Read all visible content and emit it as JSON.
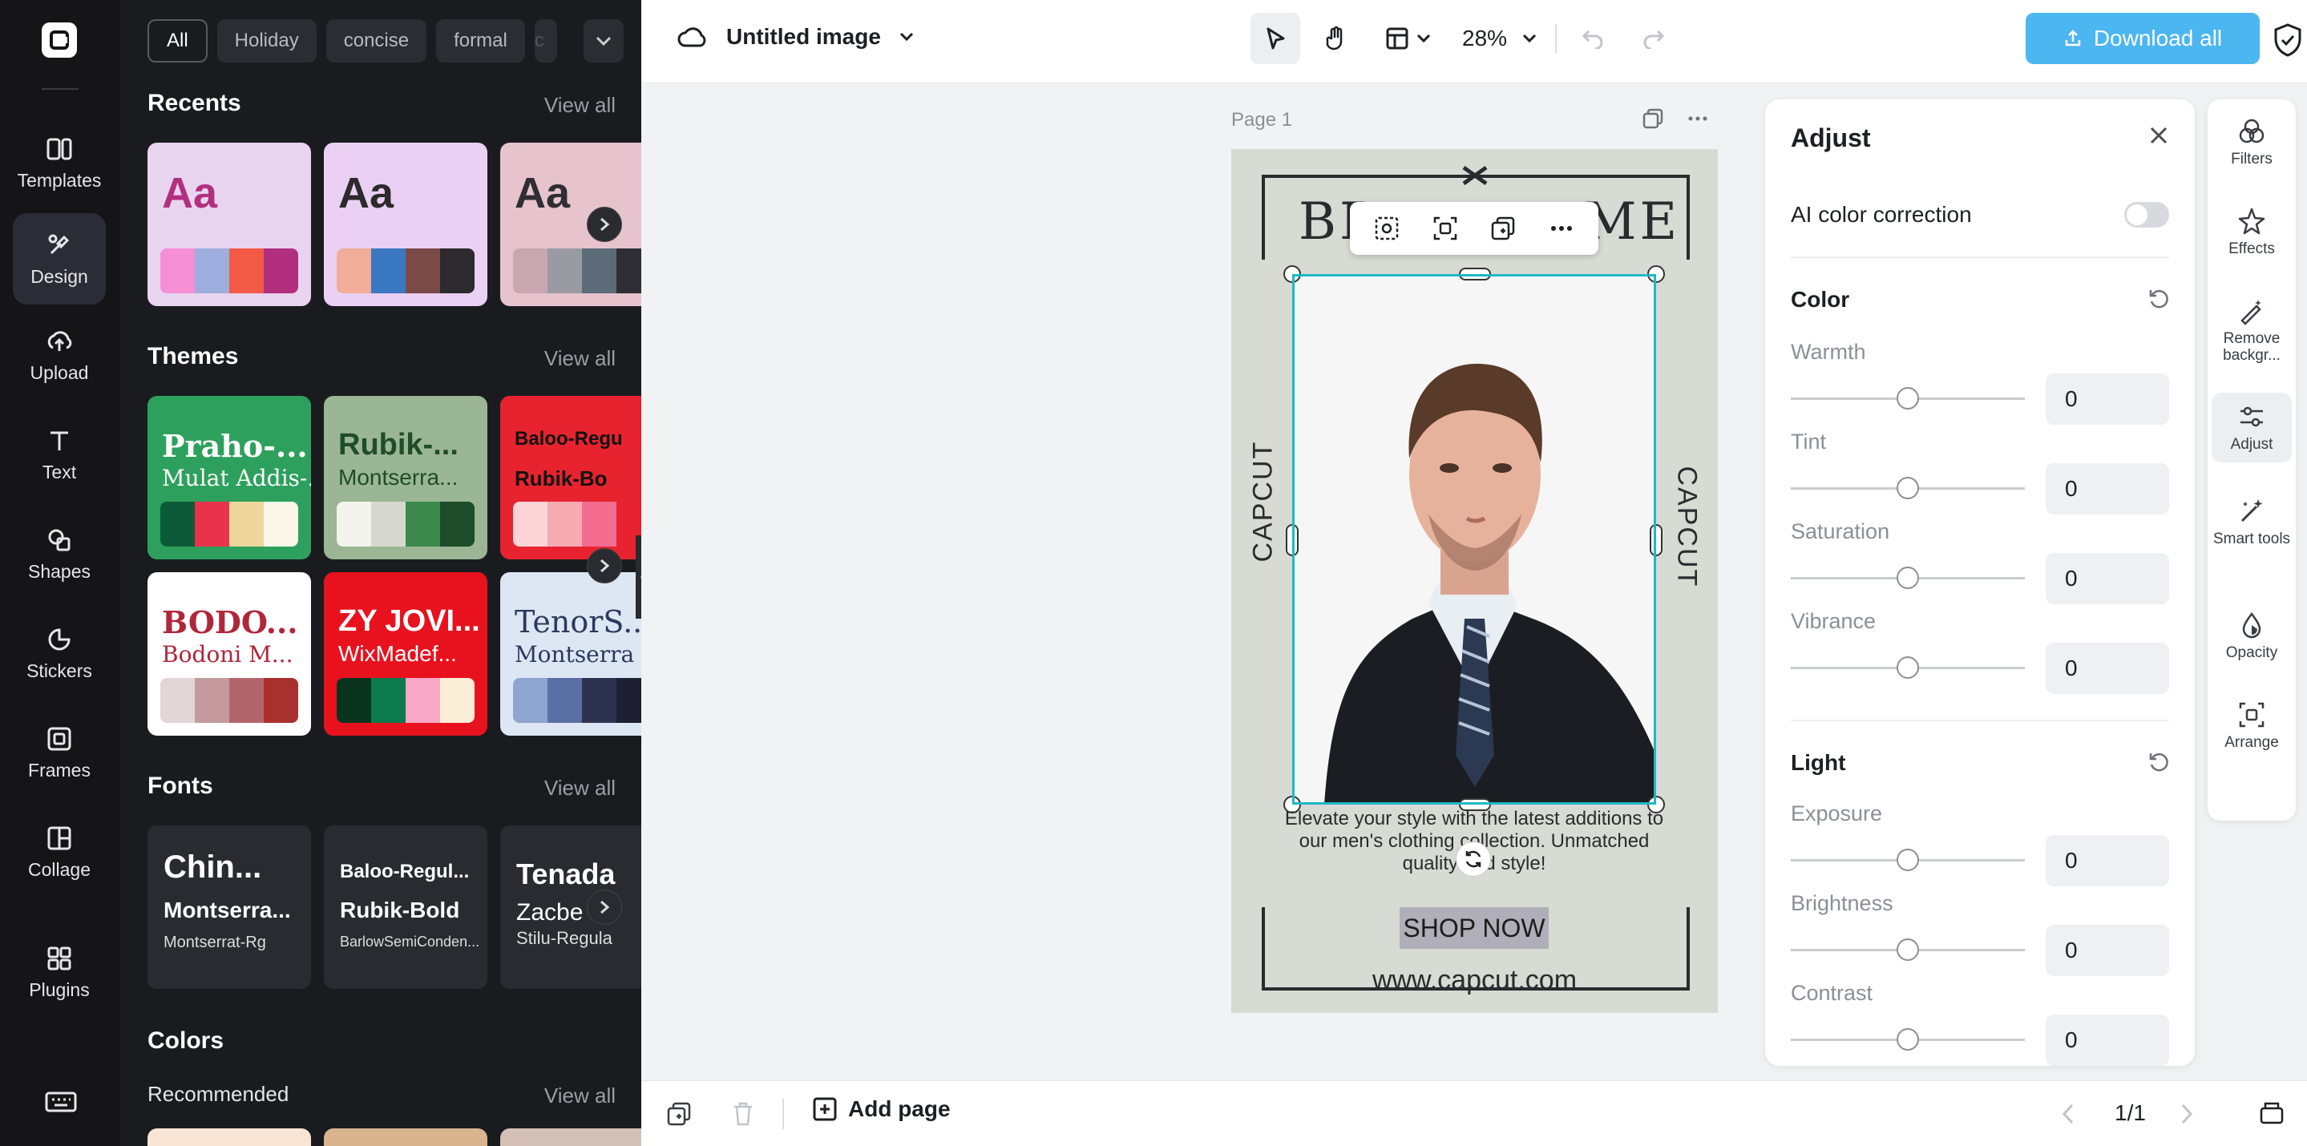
{
  "rail": {
    "items": [
      {
        "label": "Templates",
        "icon": "templates-icon"
      },
      {
        "label": "Design",
        "icon": "design-icon",
        "active": true
      },
      {
        "label": "Upload",
        "icon": "upload-icon"
      },
      {
        "label": "Text",
        "icon": "text-icon"
      },
      {
        "label": "Shapes",
        "icon": "shapes-icon"
      },
      {
        "label": "Stickers",
        "icon": "stickers-icon"
      },
      {
        "label": "Frames",
        "icon": "frames-icon"
      },
      {
        "label": "Collage",
        "icon": "collage-icon"
      },
      {
        "label": "Plugins",
        "icon": "plugins-icon"
      }
    ]
  },
  "panel": {
    "chips": [
      "All",
      "Holiday",
      "concise",
      "formal",
      "c"
    ],
    "recents": {
      "title": "Recents",
      "view_all": "View all",
      "cards": [
        {
          "text": "Aa",
          "text_color": "#b0307f",
          "bg": "#e9d4ef",
          "swatches": [
            "#f58fd6",
            "#9eaede",
            "#f25a46",
            "#b0307f"
          ]
        },
        {
          "text": "Aa",
          "text_color": "#2c2a2c",
          "bg": "#ead0f3",
          "swatches": [
            "#f1ad99",
            "#3a78c2",
            "#7a4a47",
            "#2c2a2c"
          ]
        },
        {
          "text": "Aa",
          "text_color": "#2f2e34",
          "bg": "#e6c3cd",
          "swatches": [
            "#c8a7b0",
            "#9a9aa2",
            "#5b6c78",
            "#2f2e34"
          ]
        }
      ]
    },
    "themes": {
      "title": "Themes",
      "view_all": "View all",
      "cards": [
        {
          "t1": "Praho-...",
          "t2": "Mulat Addis-...",
          "bg": "#2ea05d",
          "fg": "#ffffff",
          "swatches": [
            "#0c5a38",
            "#e8334a",
            "#efd69a",
            "#faf7ea"
          ]
        },
        {
          "t1": "Rubik-...",
          "t2": "Montserra...",
          "bg": "#9ab694",
          "fg": "#1f4c2a",
          "swatches": [
            "#f4f4ee",
            "#d6d8cf",
            "#3c8a4c",
            "#1f4c2a"
          ]
        },
        {
          "t1": "Baloo-Regu",
          "t2": "Rubik-Bo",
          "bg": "#e7232f",
          "fg": "#111111",
          "swatches": [
            "#fcd4d8",
            "#f7aab2",
            "#f26d90",
            "#e7232f"
          ]
        },
        {
          "t1": "BODO...",
          "t2": "Bodoni M...",
          "bg": "#ffffff",
          "fg": "#b0263a",
          "swatches": [
            "#e3d6d6",
            "#c49a9e",
            "#b2666b",
            "#a8302f"
          ]
        },
        {
          "t1": "ZY JOVI...",
          "t2": "WixMadef...",
          "bg": "#e8121f",
          "fg": "#ffffff",
          "swatches": [
            "#0b3420",
            "#0d7a4d",
            "#f9a8c6",
            "#fbeed9"
          ]
        },
        {
          "t1": "TenorS...",
          "t2": "Montserra",
          "bg": "#dde6f3",
          "fg": "#2a3a5c",
          "swatches": [
            "#8ea5cf",
            "#5a6fa4",
            "#2c3250",
            "#1d2030"
          ]
        }
      ]
    },
    "fonts": {
      "title": "Fonts",
      "view_all": "View all",
      "cards": [
        {
          "f1": "Chin...",
          "f2": "Montserra...",
          "f3": "Montserrat-Rg"
        },
        {
          "f1": "Baloo-Regul...",
          "f2": "Rubik-Bold",
          "f3": "BarlowSemiConden..."
        },
        {
          "f1": "Tenada",
          "f2": "Zacbe",
          "f3": "Stilu-Regula"
        }
      ]
    },
    "colors": {
      "title": "Colors",
      "recommended": "Recommended",
      "view_all": "View all",
      "swatches": [
        "#f8e5d6",
        "#d9b48f",
        "#d3c1b7"
      ]
    }
  },
  "topbar": {
    "title": "Untitled image",
    "zoom": "28%",
    "download": "Download all"
  },
  "canvas": {
    "page_label": "Page 1",
    "brand_left": "BR",
    "brand_right": "ME",
    "side_left": "CAPCUT",
    "side_right": "CAPCUT",
    "tagline": "Elevate your style with the latest additions to our men's clothing collection. Unmatched quality and style!",
    "shop": "SHOP NOW",
    "url": "www.capcut.com"
  },
  "adjust": {
    "title": "Adjust",
    "ai": "AI color correction",
    "color_section": "Color",
    "light_section": "Light",
    "color_sliders": [
      {
        "label": "Warmth",
        "value": "0"
      },
      {
        "label": "Tint",
        "value": "0"
      },
      {
        "label": "Saturation",
        "value": "0"
      },
      {
        "label": "Vibrance",
        "value": "0"
      }
    ],
    "light_sliders": [
      {
        "label": "Exposure",
        "value": "0"
      },
      {
        "label": "Brightness",
        "value": "0"
      },
      {
        "label": "Contrast",
        "value": "0"
      }
    ]
  },
  "right_tools": [
    {
      "label": "Filters"
    },
    {
      "label": "Effects"
    },
    {
      "label": "Remove backgr..."
    },
    {
      "label": "Adjust"
    },
    {
      "label": "Smart tools"
    },
    {
      "label": "Opacity"
    },
    {
      "label": "Arrange"
    }
  ],
  "bottombar": {
    "add_page": "Add page",
    "page_count": "1/1"
  }
}
